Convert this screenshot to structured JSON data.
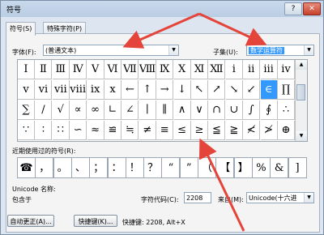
{
  "window": {
    "title": "符号"
  },
  "tabs": [
    {
      "label": "符号(S)"
    },
    {
      "label": "特殊字符(P)"
    }
  ],
  "font": {
    "label": "字体(F):",
    "value": "(普通文本)"
  },
  "subset": {
    "label": "子集(U):",
    "value": "数学运算符"
  },
  "symbols": [
    [
      "Ⅰ",
      "Ⅱ",
      "Ⅲ",
      "Ⅳ",
      "Ⅴ",
      "Ⅵ",
      "Ⅶ",
      "Ⅷ",
      "Ⅸ",
      "Ⅹ",
      "Ⅺ",
      "Ⅻ",
      "ⅰ",
      "ⅱ",
      "ⅲ",
      "ⅳ"
    ],
    [
      "ⅴ",
      "ⅵ",
      "ⅶ",
      "ⅷ",
      "ⅸ",
      "ⅹ",
      "←",
      "↑",
      "→",
      "↓",
      "↖",
      "↗",
      "↘",
      "↙",
      "∈",
      "∏"
    ],
    [
      "∑",
      "∕",
      "√",
      "∝",
      "∞",
      "∟",
      "∠",
      "∣",
      "∥",
      "∧",
      "∨",
      "∩",
      "∪",
      "∫",
      "∮",
      "∴"
    ],
    [
      "∵",
      "∶",
      "∷",
      "∽",
      "≈",
      "≌",
      "≒",
      "≠",
      "≡",
      "≤",
      "≥",
      "≦",
      "≧",
      "≮",
      "≯",
      "⊕"
    ]
  ],
  "selected": {
    "row": 1,
    "col": 14
  },
  "recent": {
    "label": "近期使用过的符号(R):",
    "items": [
      "☎",
      "，",
      "。",
      "、",
      "；",
      "：",
      "！",
      "？",
      "“",
      "”",
      "（",
      "【",
      "】",
      "%",
      "&",
      "]"
    ]
  },
  "info": {
    "unicode_name_label": "Unicode 名称:",
    "unicode_name_value": "包含于",
    "char_code_label": "字符代码(C):",
    "char_code_value": "2208",
    "from_label": "来自(M):",
    "from_value": "Unicode(十六进"
  },
  "buttons": {
    "autocorrect": "自动更正(A)...",
    "shortcut_key": "快捷键(K)...",
    "shortcut_text": "快捷键: 2208, Alt+X"
  },
  "titlebar": {
    "help": "?",
    "close": "✕"
  }
}
